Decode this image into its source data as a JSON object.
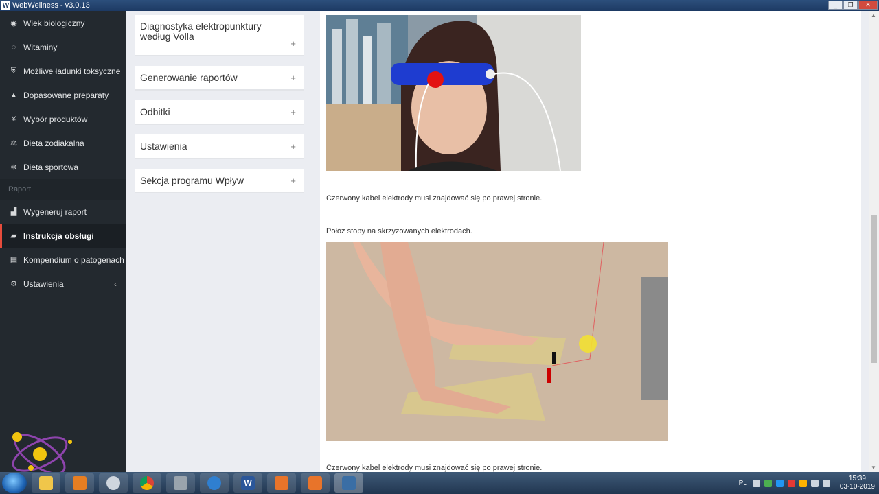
{
  "window": {
    "title": "WebWellness - v3.0.13",
    "icon_letter": "W",
    "min_label": "_",
    "max_label": "❐",
    "close_label": "✕"
  },
  "sidebar": {
    "items_top": [
      {
        "label": "Wiek biologiczny",
        "icon": "dashboard-icon"
      },
      {
        "label": "Witaminy",
        "icon": "leaf-icon"
      },
      {
        "label": "Możliwe ładunki toksyczne",
        "icon": "shield-icon"
      },
      {
        "label": "Dopasowane preparaty",
        "icon": "flask-icon"
      },
      {
        "label": "Wybór produktów",
        "icon": "cutlery-icon"
      },
      {
        "label": "Dieta zodiakalna",
        "icon": "balance-icon"
      },
      {
        "label": "Dieta sportowa",
        "icon": "ball-icon"
      }
    ],
    "section_label": "Raport",
    "items_bottom": [
      {
        "label": "Wygeneruj raport",
        "icon": "chart-icon"
      },
      {
        "label": "Instrukcja obsługi",
        "icon": "graduation-icon",
        "active": true
      },
      {
        "label": "Kompendium o patogenach",
        "icon": "book-icon"
      },
      {
        "label": "Ustawienia",
        "icon": "gear-icon",
        "caret": "‹"
      }
    ]
  },
  "accordion": {
    "items": [
      {
        "label": "Diagnostyka elektropunktury według Volla"
      },
      {
        "label": "Generowanie raportów"
      },
      {
        "label": "Odbitki"
      },
      {
        "label": "Ustawienia"
      },
      {
        "label": "Sekcja programu Wpływ"
      }
    ],
    "plus_glyph": "+"
  },
  "content": {
    "caption1": "Czerwony kabel elektrody musi znajdować się po prawej stronie.",
    "step2": "Połóż stopy na skrzyżowanych elektrodach.",
    "caption2": "Czerwony kabel elektrody musi znajdować się po prawej stronie."
  },
  "taskbar": {
    "lang": "PL",
    "time": "15:39",
    "date": "03-10-2019",
    "word_letter": "W"
  },
  "colors": {
    "sidebar_bg": "#23292f",
    "active_accent": "#e74c3c",
    "page_bg": "#ebedf2"
  }
}
